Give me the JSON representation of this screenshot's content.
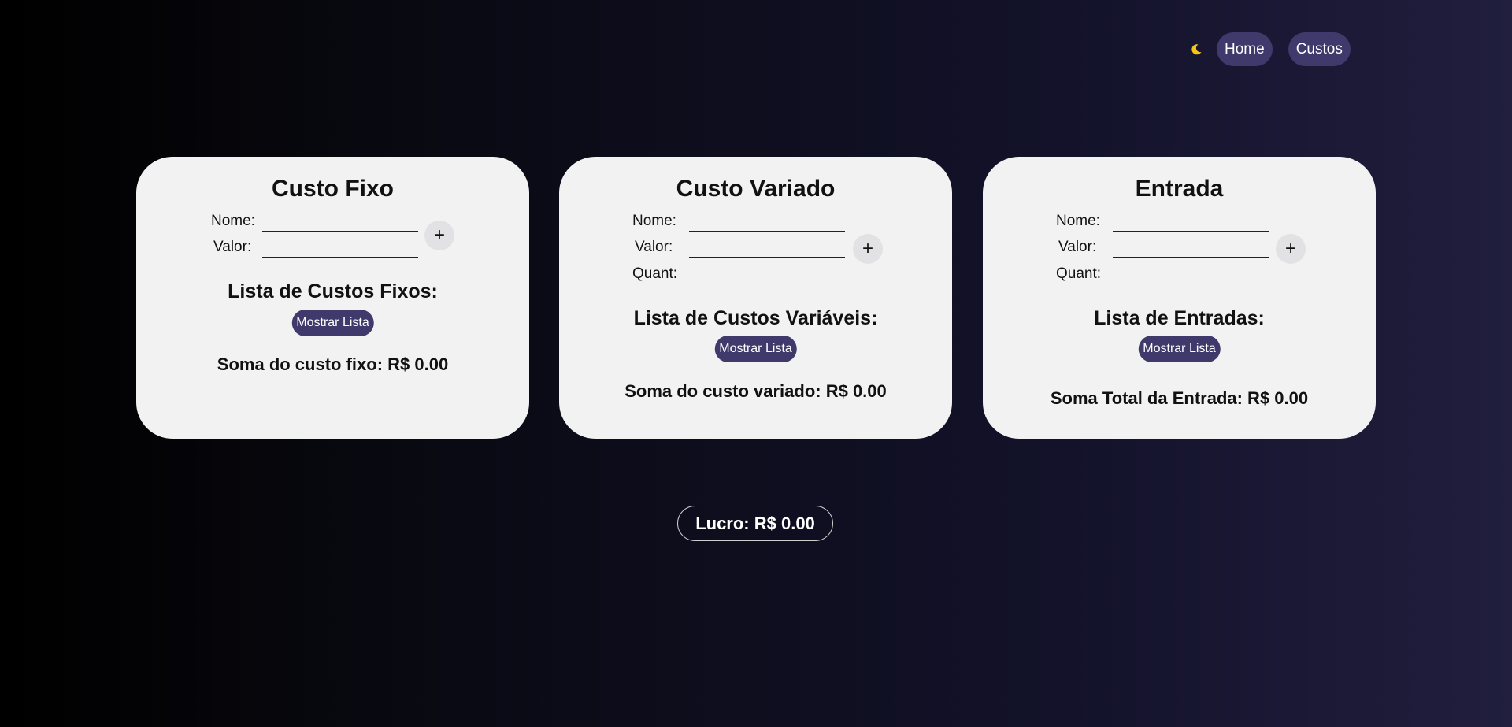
{
  "nav": {
    "theme_icon": "moon-icon",
    "theme_glyph": "🌙",
    "home_label": "Home",
    "custos_label": "Custos"
  },
  "custo_fixo": {
    "title": "Custo Fixo",
    "nome_label": "Nome:",
    "valor_label": "Valor:",
    "nome_value": "",
    "valor_value": "",
    "add_label": "+",
    "list_title": "Lista de Custos Fixos:",
    "show_label": "Mostrar Lista",
    "sum_text": "Soma do custo fixo: R$ 0.00"
  },
  "custo_variado": {
    "title": "Custo Variado",
    "nome_label": "Nome:",
    "valor_label": "Valor:",
    "quant_label": "Quant:",
    "nome_value": "",
    "valor_value": "",
    "quant_value": "",
    "add_label": "+",
    "list_title": "Lista de Custos Variáveis:",
    "show_label": "Mostrar Lista",
    "sum_text": "Soma do custo variado: R$ 0.00"
  },
  "entrada": {
    "title": "Entrada",
    "nome_label": "Nome:",
    "valor_label": "Valor:",
    "quant_label": "Quant:",
    "nome_value": "",
    "valor_value": "",
    "quant_value": "",
    "add_label": "+",
    "list_title": "Lista de Entradas:",
    "show_label": "Mostrar Lista",
    "sum_text": "Soma Total da Entrada: R$ 0.00"
  },
  "lucro": {
    "text": "Lucro: R$ 0.00"
  },
  "colors": {
    "accent": "#3f3a6b",
    "card_bg": "#f2f2f2",
    "moon": "#f5c518"
  }
}
